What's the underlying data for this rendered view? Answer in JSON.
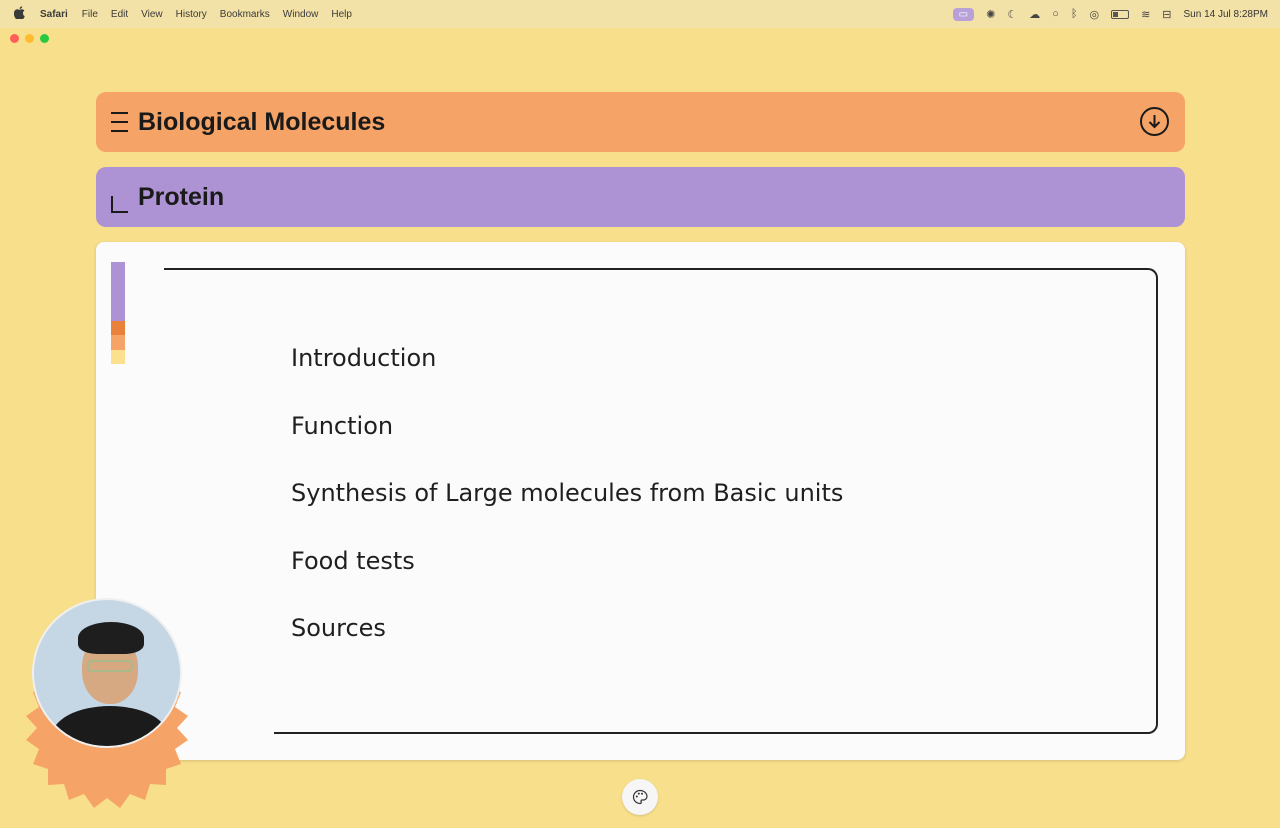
{
  "menubar": {
    "app_name": "Safari",
    "items": [
      "File",
      "Edit",
      "View",
      "History",
      "Bookmarks",
      "Window",
      "Help"
    ],
    "datetime": "Sun 14 Jul  8:28PM"
  },
  "header": {
    "title": "Biological Molecules"
  },
  "section": {
    "title": "Protein"
  },
  "topics": [
    "Introduction",
    "Function",
    "Synthesis of Large molecules from Basic units",
    "Food tests",
    "Sources"
  ],
  "colors": {
    "background": "#f8df8c",
    "orange": "#f5a366",
    "purple": "#ad92d4",
    "dark_orange": "#e8823a",
    "yellow": "#fbe08e"
  },
  "icons": {
    "menu": "menu-lines-icon",
    "section": "corner-icon",
    "download": "arrow-down-circle-icon",
    "palette": "palette-icon"
  }
}
